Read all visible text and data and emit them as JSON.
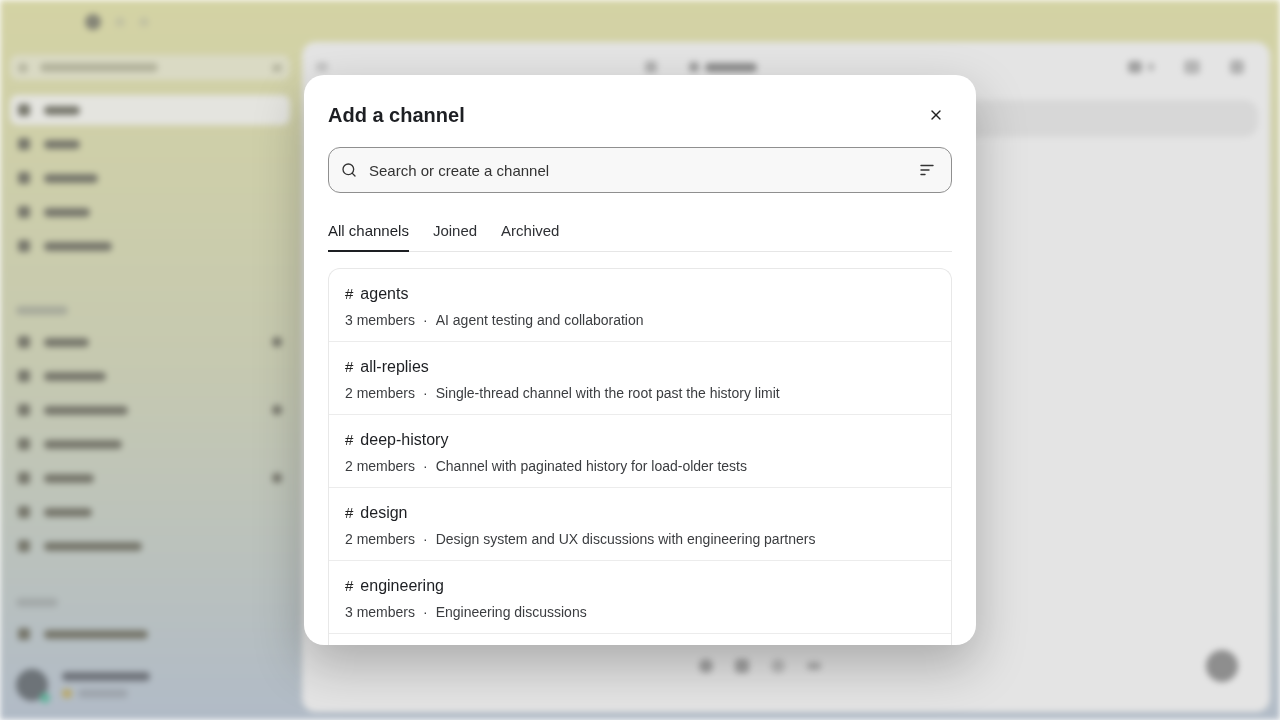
{
  "dialog": {
    "title": "Add a channel",
    "search": {
      "placeholder": "Search or create a channel"
    },
    "tabs": [
      {
        "label": "All channels",
        "selected": true
      },
      {
        "label": "Joined",
        "selected": false
      },
      {
        "label": "Archived",
        "selected": false
      }
    ],
    "channels": [
      {
        "hash": "#",
        "name": "agents",
        "members": "3 members",
        "separator": "·",
        "description": "AI agent testing and collaboration"
      },
      {
        "hash": "#",
        "name": "all-replies",
        "members": "2 members",
        "separator": "·",
        "description": "Single-thread channel with the root past the history limit"
      },
      {
        "hash": "#",
        "name": "deep-history",
        "members": "2 members",
        "separator": "·",
        "description": "Channel with paginated history for load-older tests"
      },
      {
        "hash": "#",
        "name": "design",
        "members": "2 members",
        "separator": "·",
        "description": "Design system and UX discussions with engineering partners"
      },
      {
        "hash": "#",
        "name": "engineering",
        "members": "3 members",
        "separator": "·",
        "description": "Engineering discussions"
      }
    ]
  }
}
